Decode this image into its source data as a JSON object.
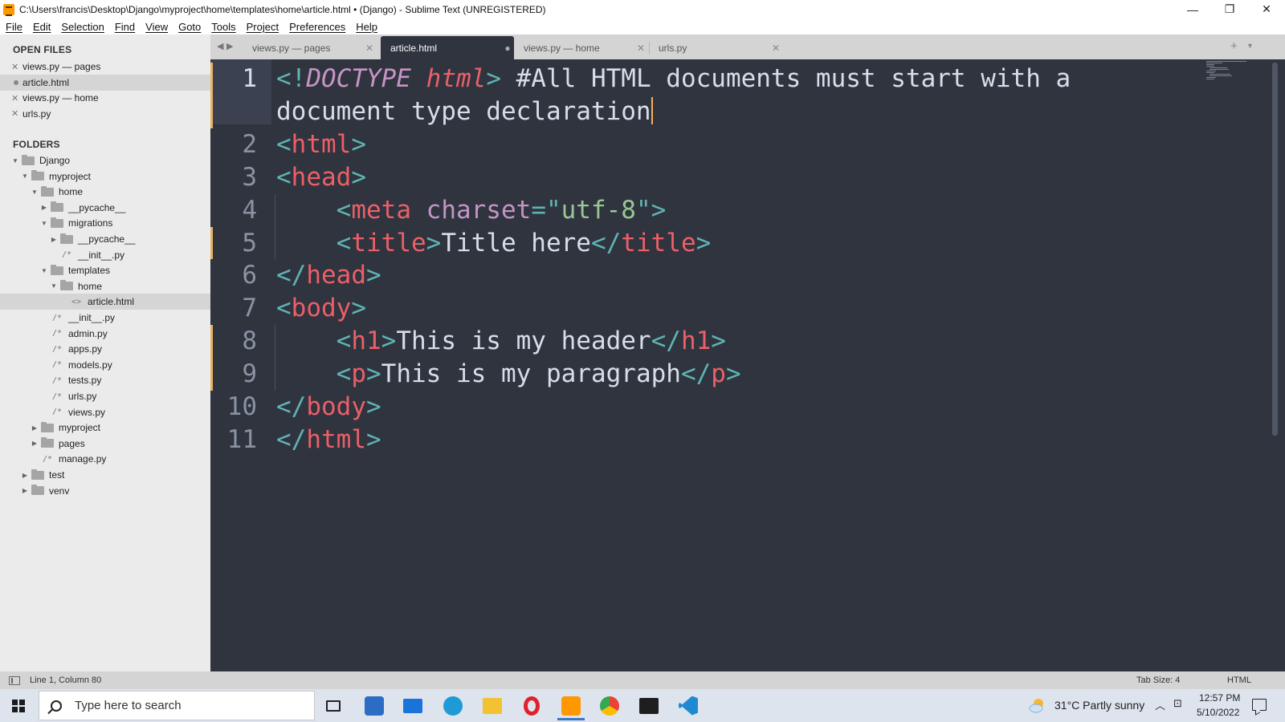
{
  "window": {
    "title": "C:\\Users\\francis\\Desktop\\Django\\myproject\\home\\templates\\home\\article.html • (Django) - Sublime Text (UNREGISTERED)",
    "minimize_glyph": "—",
    "maximize_glyph": "❐",
    "close_glyph": "✕"
  },
  "menu": [
    "File",
    "Edit",
    "Selection",
    "Find",
    "View",
    "Goto",
    "Tools",
    "Project",
    "Preferences",
    "Help"
  ],
  "sidebar": {
    "open_files_heading": "OPEN FILES",
    "open_files": [
      {
        "label": "views.py — pages",
        "state": "close"
      },
      {
        "label": "article.html",
        "state": "modified",
        "active": true
      },
      {
        "label": "views.py — home",
        "state": "close"
      },
      {
        "label": "urls.py",
        "state": "close"
      }
    ],
    "folders_heading": "FOLDERS",
    "tree": [
      {
        "label": "Django",
        "kind": "folder",
        "open": true,
        "depth": 0
      },
      {
        "label": "myproject",
        "kind": "folder",
        "open": true,
        "depth": 1
      },
      {
        "label": "home",
        "kind": "folder",
        "open": true,
        "depth": 2
      },
      {
        "label": "__pycache__",
        "kind": "folder",
        "open": false,
        "depth": 3
      },
      {
        "label": "migrations",
        "kind": "folder",
        "open": true,
        "depth": 3
      },
      {
        "label": "__pycache__",
        "kind": "folder",
        "open": false,
        "depth": 4
      },
      {
        "label": "__init__.py",
        "kind": "file",
        "depth": 4
      },
      {
        "label": "templates",
        "kind": "folder",
        "open": true,
        "depth": 3
      },
      {
        "label": "home",
        "kind": "folder",
        "open": true,
        "depth": 4
      },
      {
        "label": "article.html",
        "kind": "html",
        "depth": 5,
        "active": true
      },
      {
        "label": "__init__.py",
        "kind": "file",
        "depth": 3
      },
      {
        "label": "admin.py",
        "kind": "file",
        "depth": 3
      },
      {
        "label": "apps.py",
        "kind": "file",
        "depth": 3
      },
      {
        "label": "models.py",
        "kind": "file",
        "depth": 3
      },
      {
        "label": "tests.py",
        "kind": "file",
        "depth": 3
      },
      {
        "label": "urls.py",
        "kind": "file",
        "depth": 3
      },
      {
        "label": "views.py",
        "kind": "file",
        "depth": 3
      },
      {
        "label": "myproject",
        "kind": "folder",
        "open": false,
        "depth": 2
      },
      {
        "label": "pages",
        "kind": "folder",
        "open": false,
        "depth": 2
      },
      {
        "label": "manage.py",
        "kind": "file",
        "depth": 2
      },
      {
        "label": "test",
        "kind": "folder",
        "open": false,
        "depth": 1
      },
      {
        "label": "venv",
        "kind": "folder",
        "open": false,
        "depth": 1
      }
    ]
  },
  "tabs": [
    {
      "label": "views.py — pages",
      "active": false,
      "close": "✕"
    },
    {
      "label": "article.html",
      "active": true,
      "close": "●"
    },
    {
      "label": "views.py — home",
      "active": false,
      "close": "✕"
    },
    {
      "label": "urls.py",
      "active": false,
      "close": "✕"
    }
  ],
  "tab_controls": {
    "prev": "◀",
    "next": "▶",
    "plus": "+",
    "dropdown": "▼"
  },
  "editor": {
    "line_numbers": [
      "1",
      "2",
      "3",
      "4",
      "5",
      "6",
      "7",
      "8",
      "9",
      "10",
      "11"
    ],
    "current_line": "1",
    "modified_lines": [
      "1",
      "5",
      "8",
      "9"
    ],
    "lines": [
      [
        [
          "punct",
          "<!"
        ],
        [
          "doctype-kw",
          "DOCTYPE"
        ],
        [
          "text",
          " "
        ],
        [
          "doctype-name",
          "html"
        ],
        [
          "punct",
          ">"
        ],
        [
          "text",
          " #All HTML documents must start with a"
        ]
      ],
      [
        [
          "text",
          "document type declaration"
        ],
        [
          "cursor",
          ""
        ]
      ],
      [
        [
          "punct",
          "<"
        ],
        [
          "tag",
          "html"
        ],
        [
          "punct",
          ">"
        ]
      ],
      [
        [
          "punct",
          "<"
        ],
        [
          "tag",
          "head"
        ],
        [
          "punct",
          ">"
        ]
      ],
      [
        [
          "text",
          "    "
        ],
        [
          "punct",
          "<"
        ],
        [
          "tag",
          "meta"
        ],
        [
          "text",
          " "
        ],
        [
          "attr",
          "charset"
        ],
        [
          "punct",
          "=\""
        ],
        [
          "str",
          "utf-8"
        ],
        [
          "punct",
          "\">"
        ]
      ],
      [
        [
          "text",
          "    "
        ],
        [
          "punct",
          "<"
        ],
        [
          "tag",
          "title"
        ],
        [
          "punct",
          ">"
        ],
        [
          "text",
          "Title here"
        ],
        [
          "punct",
          "</"
        ],
        [
          "tag",
          "title"
        ],
        [
          "punct",
          ">"
        ]
      ],
      [
        [
          "punct",
          "</"
        ],
        [
          "tag",
          "head"
        ],
        [
          "punct",
          ">"
        ]
      ],
      [
        [
          "punct",
          "<"
        ],
        [
          "tag",
          "body"
        ],
        [
          "punct",
          ">"
        ]
      ],
      [
        [
          "text",
          "    "
        ],
        [
          "punct",
          "<"
        ],
        [
          "tag",
          "h1"
        ],
        [
          "punct",
          ">"
        ],
        [
          "text",
          "This is my header"
        ],
        [
          "punct",
          "</"
        ],
        [
          "tag",
          "h1"
        ],
        [
          "punct",
          ">"
        ]
      ],
      [
        [
          "text",
          "    "
        ],
        [
          "punct",
          "<"
        ],
        [
          "tag",
          "p"
        ],
        [
          "punct",
          ">"
        ],
        [
          "text",
          "This is my paragraph"
        ],
        [
          "punct",
          "</"
        ],
        [
          "tag",
          "p"
        ],
        [
          "punct",
          ">"
        ]
      ],
      [
        [
          "punct",
          "</"
        ],
        [
          "tag",
          "body"
        ],
        [
          "punct",
          ">"
        ]
      ],
      [
        [
          "punct",
          "</"
        ],
        [
          "tag",
          "html"
        ],
        [
          "punct",
          ">"
        ]
      ]
    ]
  },
  "status": {
    "position": "Line 1, Column 80",
    "tab_size": "Tab Size: 4",
    "syntax": "HTML"
  },
  "taskbar": {
    "search_placeholder": "Type here to search",
    "apps": [
      {
        "name": "task-view-icon",
        "color": "#222222"
      },
      {
        "name": "microsoft-store-icon",
        "color": "#2b6cc4"
      },
      {
        "name": "mail-icon",
        "color": "#1a73d8"
      },
      {
        "name": "edge-icon",
        "color": "#1e9bd7"
      },
      {
        "name": "file-explorer-icon",
        "color": "#f2c230"
      },
      {
        "name": "opera-icon",
        "color": "#e0202c"
      },
      {
        "name": "sublime-text-icon",
        "color": "#ff9800",
        "active": true
      },
      {
        "name": "chrome-icon",
        "color": "#34a853"
      },
      {
        "name": "terminal-icon",
        "color": "#1e1e1e"
      },
      {
        "name": "vscode-icon",
        "color": "#1f8ad2"
      }
    ],
    "weather": "31°C  Partly sunny",
    "clock_time": "12:57 PM",
    "clock_date": "5/10/2022"
  },
  "colors": {
    "editor_bg": "#2f343f",
    "sidebar_bg": "#ebebeb",
    "accent_modified": "#e8b564",
    "tag": "#ec5f67",
    "punct": "#5fb3b3",
    "attr": "#c594c5",
    "string": "#99c794",
    "text": "#d8dee9"
  }
}
